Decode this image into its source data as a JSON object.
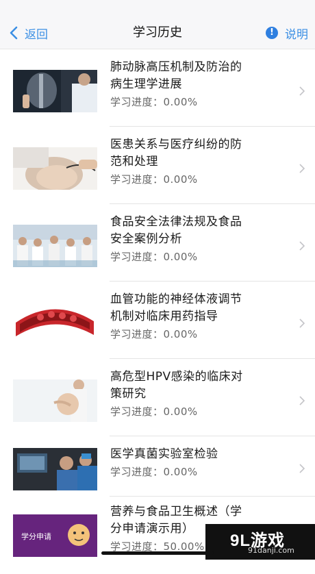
{
  "nav": {
    "back_label": "返回",
    "title": "学习历史",
    "help_label": "说明",
    "accent_color": "#3b8fe4"
  },
  "courses": [
    {
      "title_line1": "肺动脉高压机制及防治的",
      "title_line2": "病生理学进展",
      "progress": "学习进度：0.00%",
      "thumb": "xray-doctor-image"
    },
    {
      "title_line1": "医患关系与医疗纠纷的防",
      "title_line2": "范和处理",
      "progress": "学习进度：0.00%",
      "thumb": "pregnant-stethoscope-image"
    },
    {
      "title_line1": "食品安全法律法规及食品",
      "title_line2": "安全案例分析",
      "progress": "学习进度：0.00%",
      "thumb": "medical-team-image"
    },
    {
      "title_line1": "血管功能的神经体液调节",
      "title_line2": "机制对临床用药指导",
      "progress": "学习进度：0.00%",
      "thumb": "blood-vessel-image"
    },
    {
      "title_line1": "高危型HPV感染的临床对",
      "title_line2": "策研究",
      "progress": "学习进度：0.00%",
      "thumb": "pregnant-woman-image"
    },
    {
      "title_line1": "医学真菌实验室检验",
      "title_line2": "",
      "progress": "学习进度：0.00%",
      "thumb": "lab-doctor-image"
    },
    {
      "title_line1": "营养与食品卫生概述（学",
      "title_line2": "分申请演示用）",
      "progress": "学习进度：50.00%",
      "thumb": "credit-apply-image",
      "thumb_text": "学分申请"
    }
  ],
  "watermark": {
    "logo": "9L游戏",
    "url": "91danji.com"
  }
}
